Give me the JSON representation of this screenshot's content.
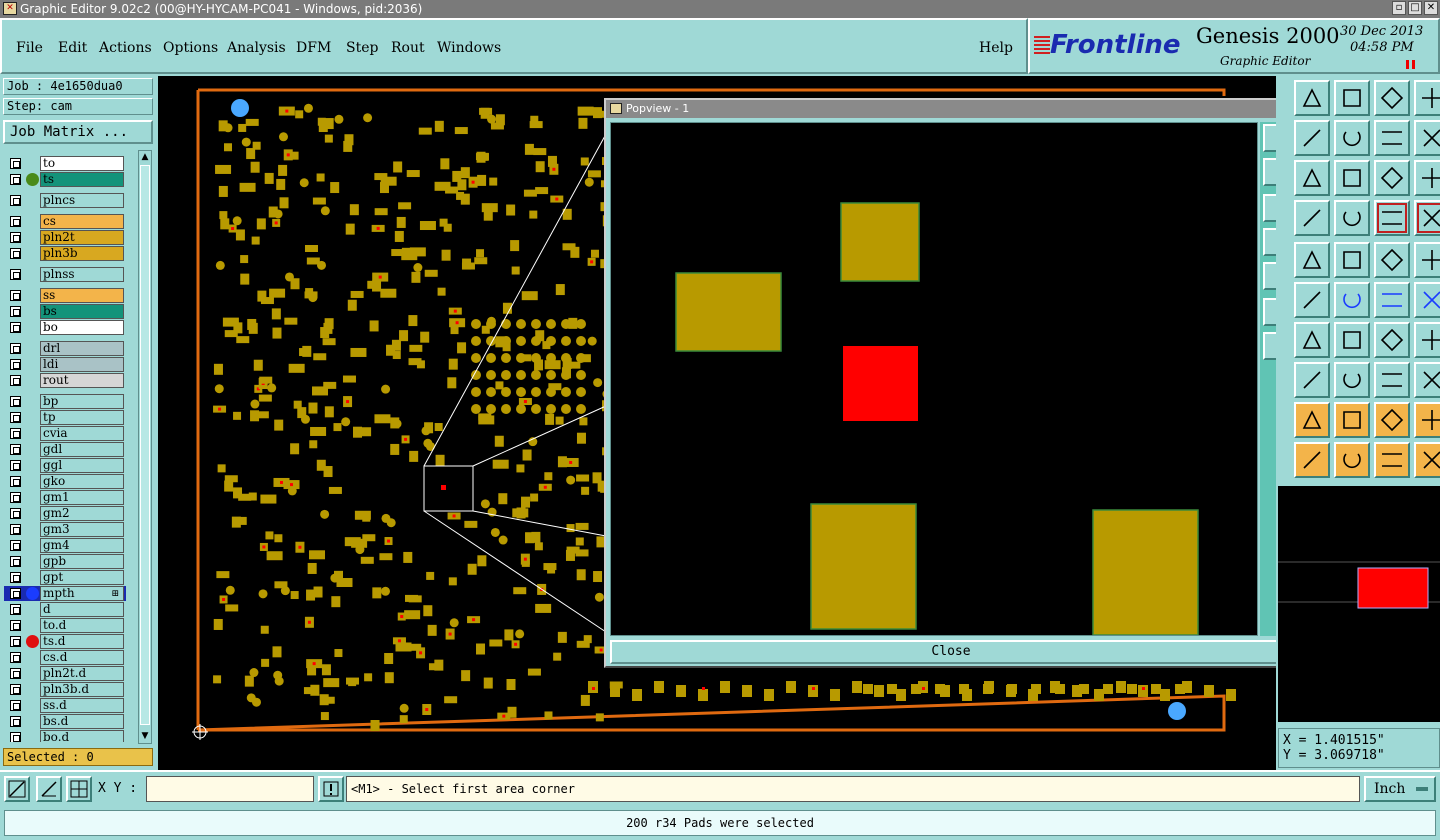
{
  "window": {
    "title": "Graphic Editor 9.02c2 (00@HY-HYCAM-PC041 - Windows, pid:2036)",
    "buttons": [
      "restore-icon",
      "maximize-icon",
      "close-icon"
    ]
  },
  "menubar": {
    "items": [
      "File",
      "Edit",
      "Actions",
      "Options",
      "Analysis",
      "DFM",
      "Step",
      "Rout",
      "Windows"
    ],
    "help": "Help"
  },
  "brand": {
    "logo": "Frontline",
    "product": "Genesis 2000",
    "subtitle": "Graphic Editor",
    "date": "30 Dec 2013",
    "time": "04:58 PM"
  },
  "left": {
    "job": "Job : 4e1650dua0",
    "step": "Step: cam",
    "job_matrix": "Job Matrix ...",
    "selected": "Selected : 0",
    "layers": [
      {
        "name": "to",
        "color": "#ffffff",
        "dot": ""
      },
      {
        "name": "ts",
        "color": "#13937a",
        "dot": "#4a8a1a"
      },
      {
        "name": "plncs",
        "color": "#9fd9d6",
        "dot": ""
      },
      {
        "name": "cs",
        "color": "#f3b44a",
        "dot": ""
      },
      {
        "name": "pln2t",
        "color": "#d8a820",
        "dot": ""
      },
      {
        "name": "pln3b",
        "color": "#d8a820",
        "dot": ""
      },
      {
        "name": "plnss",
        "color": "#9fd9d6",
        "dot": ""
      },
      {
        "name": "ss",
        "color": "#f3b44a",
        "dot": ""
      },
      {
        "name": "bs",
        "color": "#13937a",
        "dot": ""
      },
      {
        "name": "bo",
        "color": "#ffffff",
        "dot": ""
      },
      {
        "name": "drl",
        "color": "#a9c2c6",
        "dot": ""
      },
      {
        "name": "ldi",
        "color": "#a9c2c6",
        "dot": ""
      },
      {
        "name": "rout",
        "color": "#d6d6d6",
        "dot": ""
      },
      {
        "name": "bp",
        "color": "#9fd9d6",
        "dot": ""
      },
      {
        "name": "tp",
        "color": "#9fd9d6",
        "dot": ""
      },
      {
        "name": "cvia",
        "color": "#9fd9d6",
        "dot": ""
      },
      {
        "name": "gdl",
        "color": "#9fd9d6",
        "dot": ""
      },
      {
        "name": "ggl",
        "color": "#9fd9d6",
        "dot": ""
      },
      {
        "name": "gko",
        "color": "#9fd9d6",
        "dot": ""
      },
      {
        "name": "gm1",
        "color": "#9fd9d6",
        "dot": ""
      },
      {
        "name": "gm2",
        "color": "#9fd9d6",
        "dot": ""
      },
      {
        "name": "gm3",
        "color": "#9fd9d6",
        "dot": ""
      },
      {
        "name": "gm4",
        "color": "#9fd9d6",
        "dot": ""
      },
      {
        "name": "gpb",
        "color": "#9fd9d6",
        "dot": ""
      },
      {
        "name": "gpt",
        "color": "#9fd9d6",
        "dot": ""
      },
      {
        "name": "mpth",
        "color": "#9fd9d6",
        "dot": "#1a3cff",
        "active": true
      },
      {
        "name": "d",
        "color": "#9fd9d6",
        "dot": ""
      },
      {
        "name": "to.d",
        "color": "#9fd9d6",
        "dot": ""
      },
      {
        "name": "ts.d",
        "color": "#9fd9d6",
        "dot": "#e01010"
      },
      {
        "name": "cs.d",
        "color": "#9fd9d6",
        "dot": ""
      },
      {
        "name": "pln2t.d",
        "color": "#9fd9d6",
        "dot": ""
      },
      {
        "name": "pln3b.d",
        "color": "#9fd9d6",
        "dot": ""
      },
      {
        "name": "ss.d",
        "color": "#9fd9d6",
        "dot": ""
      },
      {
        "name": "bs.d",
        "color": "#9fd9d6",
        "dot": ""
      },
      {
        "name": "bo.d",
        "color": "#9fd9d6",
        "dot": ""
      }
    ]
  },
  "popview": {
    "title": "Popview - 1",
    "close_label": "Close"
  },
  "right": {
    "x": "X = 1.401515\"",
    "y": "Y = 3.069718\""
  },
  "bottom": {
    "xy_label": "X Y :",
    "xy_value": "",
    "message": "<M1> - Select first area corner",
    "units": "Inch",
    "status": "200 r34 Pads were selected"
  },
  "colors": {
    "pad": "#b89a00",
    "selected_pad": "#ff0000",
    "outline": "#e06a10",
    "background": "#9fd9d6"
  }
}
